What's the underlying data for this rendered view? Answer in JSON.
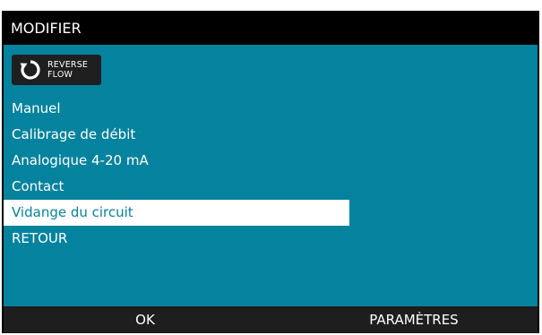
{
  "header": {
    "title": "MODIFIER"
  },
  "badge": {
    "icon": "reverse-flow-icon",
    "line1": "REVERSE",
    "line2": "FLOW"
  },
  "menu": {
    "items": [
      {
        "label": "Manuel"
      },
      {
        "label": "Calibrage de débit"
      },
      {
        "label": "Analogique 4-20 mA"
      },
      {
        "label": "Contact"
      },
      {
        "label": "Vidange du circuit",
        "selected": true
      },
      {
        "label": "RETOUR"
      }
    ]
  },
  "softkeys": {
    "left": "OK",
    "right": "PARAMÈTRES"
  },
  "colors": {
    "background": "#05839e",
    "bars": "#000000",
    "selection": "#ffffff",
    "badge": "#1f1f1f"
  }
}
